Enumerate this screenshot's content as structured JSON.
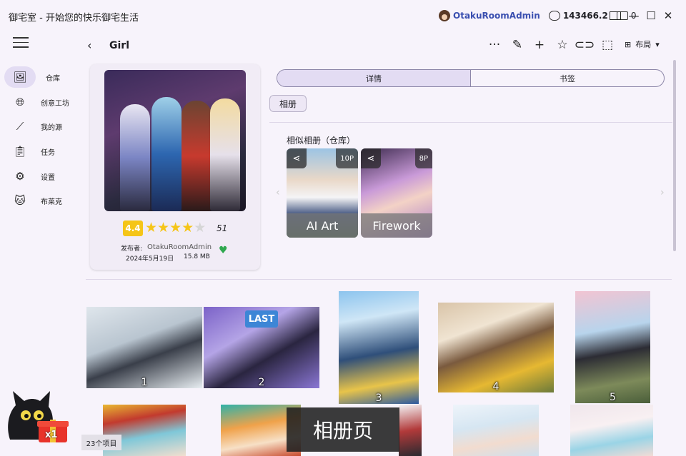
{
  "window": {
    "title": "御宅室 - 开始您的快乐御宅生活",
    "username": "OtakuRoomAdmin",
    "coins": "143466.2",
    "tickets": "0"
  },
  "sidebar": {
    "items": [
      {
        "label": "仓库",
        "icon": "warehouse-icon"
      },
      {
        "label": "创意工坊",
        "icon": "globe-icon"
      },
      {
        "label": "我的源",
        "icon": "source-icon"
      },
      {
        "label": "任务",
        "icon": "task-icon"
      },
      {
        "label": "设置",
        "icon": "gear-icon"
      },
      {
        "label": "布莱克",
        "icon": "cat-icon"
      }
    ]
  },
  "header": {
    "title": "Girl",
    "layout_label": "布局"
  },
  "album": {
    "rating": "4.4",
    "stars": 4.4,
    "rating_count": "51",
    "publisher_label": "发布者:",
    "publisher": "OtakuRoomAdmin",
    "date": "2024年5月19日",
    "size": "15.8 MB"
  },
  "tabs": [
    "详情",
    "书签"
  ],
  "chip": "相册",
  "similar": {
    "title": "相似相册（仓库）",
    "items": [
      {
        "caption": "AI Art",
        "count": "10P"
      },
      {
        "caption": "Firework",
        "count": "8P"
      }
    ]
  },
  "gallery": {
    "badge": "LAST",
    "numbers": [
      "1",
      "2",
      "3",
      "4",
      "5"
    ]
  },
  "footer": {
    "count": "23个项目",
    "toast": "相册页",
    "gift_count": "x1"
  },
  "colors": {
    "accent": "#e3dcf3",
    "star": "#f5c518",
    "badge_blue": "#3d86d6",
    "user_link": "#3a4fb0"
  }
}
